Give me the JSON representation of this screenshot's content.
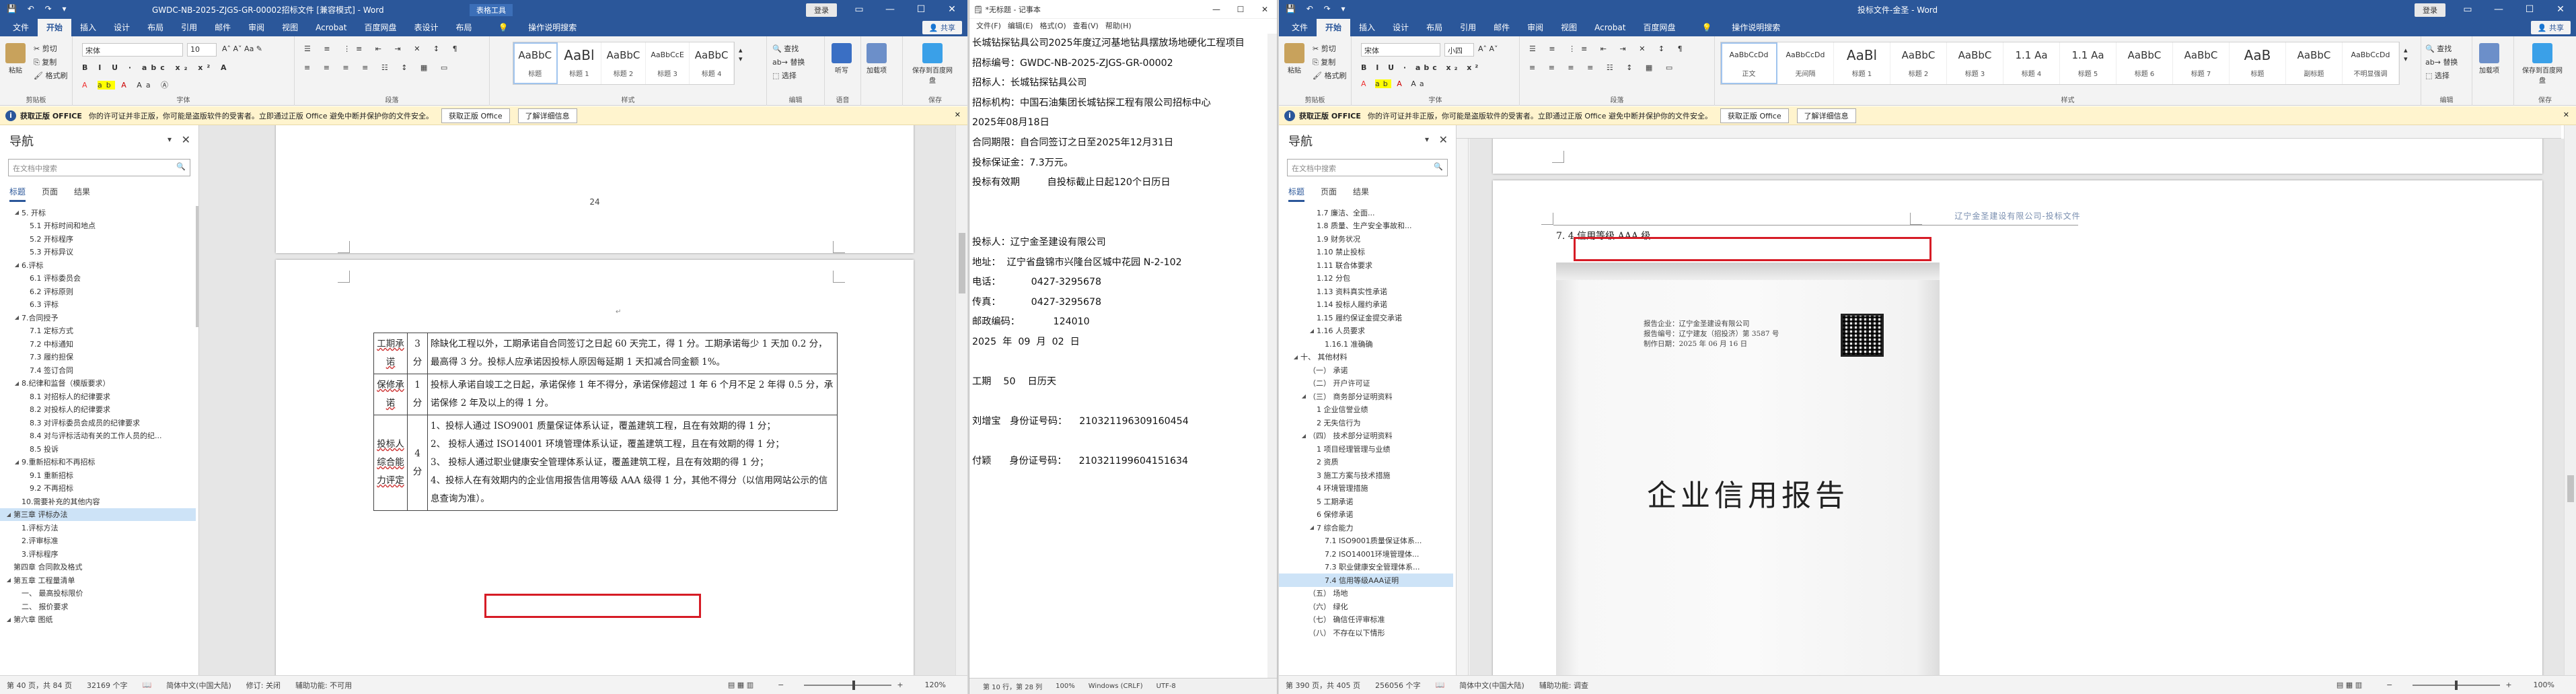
{
  "left_window": {
    "title": "GWDC-NB-2025-ZJGS-GR-00002招标文件 [兼容模式] - Word",
    "context_tab": "表格工具",
    "login": "登录",
    "menu": [
      "文件",
      "开始",
      "插入",
      "设计",
      "布局",
      "引用",
      "邮件",
      "审阅",
      "视图",
      "Acrobat",
      "百度网盘",
      "表设计",
      "布局"
    ],
    "tell_me": "操作说明搜索",
    "share": "共享",
    "ribbon": {
      "paste": "粘贴",
      "cut": "剪切",
      "copy": "复制",
      "format_painter": "格式刷",
      "clipboard": "剪贴板",
      "font_name": "宋体",
      "font_size": "10",
      "font": "字体",
      "paragraph": "段落",
      "styles_label": "样式",
      "styles": [
        {
          "sample": "AaBbC",
          "name": "标题"
        },
        {
          "sample": "AaBl",
          "name": "标题 1"
        },
        {
          "sample": "AaBbC",
          "name": "标题 2"
        },
        {
          "sample": "AaBbCcE",
          "name": "标题 3"
        },
        {
          "sample": "AaBbC",
          "name": "标题 4"
        }
      ],
      "find": "查找",
      "replace": "替换",
      "select": "选择",
      "editing": "编辑",
      "dictate": "听写",
      "voice": "语音",
      "addins": "加载项",
      "save_to_baidu": "保存到百度网盘",
      "save": "保存"
    },
    "warning": {
      "title": "获取正版 OFFICE",
      "text": "你的许可证并非正版，你可能是盗版软件的受害者。立即通过正版 Office 避免中断并保护你的文件安全。",
      "btn1": "获取正版 Office",
      "btn2": "了解详细信息"
    },
    "nav": {
      "title": "导航",
      "search_placeholder": "在文档中搜索",
      "tabs": [
        "标题",
        "页面",
        "结果"
      ],
      "items": [
        {
          "label": "5. 开标",
          "level": 1,
          "toggle": "◢"
        },
        {
          "label": "5.1 开标时间和地点",
          "level": 2,
          "toggle": ""
        },
        {
          "label": "5.2 开标程序",
          "level": 2,
          "toggle": ""
        },
        {
          "label": "5.3 开标异议",
          "level": 2,
          "toggle": ""
        },
        {
          "label": "6.评标",
          "level": 1,
          "toggle": "◢"
        },
        {
          "label": "6.1 评标委员会",
          "level": 2,
          "toggle": ""
        },
        {
          "label": "6.2 评标原则",
          "level": 2,
          "toggle": ""
        },
        {
          "label": "6.3 评标",
          "level": 2,
          "toggle": ""
        },
        {
          "label": "7.合同授予",
          "level": 1,
          "toggle": "◢"
        },
        {
          "label": "7.1 定标方式",
          "level": 2,
          "toggle": ""
        },
        {
          "label": "7.2 中标通知",
          "level": 2,
          "toggle": ""
        },
        {
          "label": "7.3 履约担保",
          "level": 2,
          "toggle": ""
        },
        {
          "label": "7.4 签订合同",
          "level": 2,
          "toggle": ""
        },
        {
          "label": "8.纪律和监督（模版要求）",
          "level": 1,
          "toggle": "◢"
        },
        {
          "label": "8.1 对招标人的纪律要求",
          "level": 2,
          "toggle": ""
        },
        {
          "label": "8.2 对投标人的纪律要求",
          "level": 2,
          "toggle": ""
        },
        {
          "label": "8.3 对评标委员会成员的纪律要求",
          "level": 2,
          "toggle": ""
        },
        {
          "label": "8.4 对与评标活动有关的工作人员的纪...",
          "level": 2,
          "toggle": ""
        },
        {
          "label": "8.5 投诉",
          "level": 2,
          "toggle": ""
        },
        {
          "label": "9.重新招标和不再招标",
          "level": 1,
          "toggle": "◢"
        },
        {
          "label": "9.1 重新招标",
          "level": 2,
          "toggle": ""
        },
        {
          "label": "9.2 不再招标",
          "level": 2,
          "toggle": ""
        },
        {
          "label": "10.需要补充的其他内容",
          "level": 1,
          "toggle": ""
        },
        {
          "label": "第三章 评标办法",
          "level": 0,
          "toggle": "◢",
          "sel": true
        },
        {
          "label": "1.评标方法",
          "level": 1,
          "toggle": ""
        },
        {
          "label": "2.评审标准",
          "level": 1,
          "toggle": ""
        },
        {
          "label": "3.评标程序",
          "level": 1,
          "toggle": ""
        },
        {
          "label": "第四章 合同款及格式",
          "level": 0,
          "toggle": ""
        },
        {
          "label": "第五章 工程量清单",
          "level": 0,
          "toggle": "◢"
        },
        {
          "label": "一、 最高投标限价",
          "level": 1,
          "toggle": ""
        },
        {
          "label": "二、 报价要求",
          "level": 1,
          "toggle": ""
        },
        {
          "label": "第六章 图纸",
          "level": 0,
          "toggle": "◢"
        }
      ]
    },
    "page_number": "24",
    "table_rows": [
      {
        "name": "工期承诺",
        "score": "3分",
        "text": "除缺化工程以外，工期承诺自合同签订之日起 60 天完工，得 1 分。工期承诺每少 1 天加 0.2 分，最高得 3 分。投标人应承诺因投标人原因每延期 1 天扣减合同金额 1%。"
      },
      {
        "name": "保修承诺",
        "score": "1分",
        "text": "投标人承诺自竣工之日起，承诺保修 1 年不得分，承诺保修超过 1 年 6 个月不足 2 年得 0.5 分，承诺保修 2 年及以上的得 1 分。"
      },
      {
        "name": "投标人综合能力评定",
        "score": "4分",
        "lines": [
          "1、投标人通过 ISO9001 质量保证体系认证，覆盖建筑工程，且在有效期的得 1 分；",
          "2、 投标人通过 ISO14001 环境管理体系认证，覆盖建筑工程，且在有效期的得 1 分；",
          "3、 投标人通过职业健康安全管理体系认证，覆盖建筑工程，且在有效期的得 1 分；",
          "4、投标人在有效期内的企业信用报告信用等级 AAA 级得 1 分，其他不得分（以信用网站公示的信息查询为准）。"
        ]
      }
    ],
    "status": {
      "page": "第 40 页，共 84 页",
      "words": "32169 个字",
      "lang": "简体中文(中国大陆)",
      "track": "修订: 关闭",
      "access": "辅助功能: 不可用",
      "zoom": "120%"
    }
  },
  "notepad": {
    "title": "*无标题 - 记事本",
    "menu": [
      "文件(F)",
      "编辑(E)",
      "格式(O)",
      "查看(V)",
      "帮助(H)"
    ],
    "lines": [
      "长城钻探钻具公司2025年度辽河基地钻具摆放场地硬化工程项目",
      "招标编号：GWDC-NB-2025-ZJGS-GR-00002",
      "招标人：长城钻探钻具公司",
      "招标机构：中国石油集团长城钻探工程有限公司招标中心",
      "2025年08月18日",
      "合同期限：自合同签订之日至2025年12月31日",
      "投标保证金：7.3万元。",
      "投标有效期         自投标截止日起120个日历日",
      "",
      "",
      "投标人：辽宁金圣建设有限公司",
      "地址：  辽宁省盘锦市兴隆台区城中花园 N-2-102",
      "电话：          0427-3295678",
      "传真：          0427-3295678",
      "邮政编码：           124010",
      "2025  年  09  月  02  日",
      "",
      "工期    50    日历天",
      "",
      "刘增宝   身份证号码：    210321196309160454",
      "",
      "付颖      身份证号码：    210321199604151634"
    ],
    "status": [
      "第 10 行，第 28 列",
      "100%",
      "Windows (CRLF)",
      "UTF-8"
    ]
  },
  "right_window": {
    "title": "投标文件-金圣 - Word",
    "login": "登录",
    "menu": [
      "文件",
      "开始",
      "插入",
      "设计",
      "布局",
      "引用",
      "邮件",
      "审阅",
      "视图",
      "Acrobat",
      "百度网盘"
    ],
    "tell_me": "操作说明搜索",
    "share": "共享",
    "ribbon": {
      "font_name": "宋体",
      "font_size": "小四",
      "styles": [
        {
          "sample": "AaBbCcDd",
          "name": "正文"
        },
        {
          "sample": "AaBbCcDd",
          "name": "无间隔"
        },
        {
          "sample": "AaBl",
          "name": "标题 1"
        },
        {
          "sample": "AaBbC",
          "name": "标题 2"
        },
        {
          "sample": "AaBbC",
          "name": "标题 3"
        },
        {
          "sample": "1.1 Aa",
          "name": "标题 4"
        },
        {
          "sample": "1.1 Aa",
          "name": "标题 5"
        },
        {
          "sample": "AaBbC",
          "name": "标题 6"
        },
        {
          "sample": "AaBbC",
          "name": "标题 7"
        },
        {
          "sample": "AaB",
          "name": "标题"
        },
        {
          "sample": "AaBbC",
          "name": "副标题"
        },
        {
          "sample": "AaBbCcDd",
          "name": "不明显强调"
        }
      ]
    },
    "nav": {
      "title": "导航",
      "search_placeholder": "在文档中搜索",
      "tabs": [
        "标题",
        "页面",
        "结果"
      ],
      "items": [
        {
          "label": "1.7 廉洁、全面...",
          "level": 3,
          "toggle": ""
        },
        {
          "label": "1.8 质量、生产安全事故和...",
          "level": 3,
          "toggle": ""
        },
        {
          "label": "1.9 财务状况",
          "level": 3,
          "toggle": ""
        },
        {
          "label": "1.10 禁止投标",
          "level": 3,
          "toggle": ""
        },
        {
          "label": "1.11 联合体要求",
          "level": 3,
          "toggle": ""
        },
        {
          "label": "1.12 分包",
          "level": 3,
          "toggle": ""
        },
        {
          "label": "1.13 资料真实性承诺",
          "level": 3,
          "toggle": ""
        },
        {
          "label": "1.14 投标人履约承诺",
          "level": 3,
          "toggle": ""
        },
        {
          "label": "1.15 履约保证金提交承诺",
          "level": 3,
          "toggle": ""
        },
        {
          "label": "1.16 人员要求",
          "level": 3,
          "toggle": "◢"
        },
        {
          "label": "1.16.1 准确确",
          "level": 4,
          "toggle": ""
        },
        {
          "label": "十、 其他材料",
          "level": 1,
          "toggle": "◢"
        },
        {
          "label": "（一） 承诺",
          "level": 2,
          "toggle": ""
        },
        {
          "label": "（二） 开户许可证",
          "level": 2,
          "toggle": ""
        },
        {
          "label": "（三） 商务部分证明资料",
          "level": 2,
          "toggle": "◢"
        },
        {
          "label": "1 企业信誉业绩",
          "level": 3,
          "toggle": ""
        },
        {
          "label": "2 无失信行为",
          "level": 3,
          "toggle": ""
        },
        {
          "label": "（四） 技术部分证明资料",
          "level": 2,
          "toggle": "◢"
        },
        {
          "label": "1 项目经理管理与业绩",
          "level": 3,
          "toggle": ""
        },
        {
          "label": "2 资质",
          "level": 3,
          "toggle": ""
        },
        {
          "label": "3 施工方案与技术措施",
          "level": 3,
          "toggle": ""
        },
        {
          "label": "4 环境管理措施",
          "level": 3,
          "toggle": ""
        },
        {
          "label": "5 工期承诺",
          "level": 3,
          "toggle": ""
        },
        {
          "label": "6 保修承诺",
          "level": 3,
          "toggle": ""
        },
        {
          "label": "7 综合能力",
          "level": 3,
          "toggle": "◢"
        },
        {
          "label": "7.1 ISO9001质量保证体系...",
          "level": 4,
          "toggle": ""
        },
        {
          "label": "7.2 ISO14001环境管理体...",
          "level": 4,
          "toggle": ""
        },
        {
          "label": "7.3 职业健康安全管理体系...",
          "level": 4,
          "toggle": ""
        },
        {
          "label": "7.4 信用等级AAA证明",
          "level": 4,
          "toggle": "",
          "sel": true
        },
        {
          "label": "（五） 场地",
          "level": 2,
          "toggle": ""
        },
        {
          "label": "（六） 绿化",
          "level": 2,
          "toggle": ""
        },
        {
          "label": "（七） 确信任评审标准",
          "level": 2,
          "toggle": ""
        },
        {
          "label": "（八） 不存在以下情形",
          "level": 2,
          "toggle": ""
        }
      ]
    },
    "page_header": "辽宁金圣建设有限公司-投标文件",
    "heading": "7. 4 信用等级 AAA 级",
    "report": {
      "line1": "报告企业：辽宁金圣建设有限公司",
      "line2": "报告编号：辽宁建友（招投济）第 3587 号",
      "line3": "制作日期：2025 年 06 月 16 日",
      "title": "企业信用报告"
    },
    "status": {
      "page": "第 390 页，共 405 页",
      "words": "256056 个字",
      "lang": "简体中文(中国大陆)",
      "access": "辅助功能: 调查",
      "zoom": "100%"
    }
  }
}
